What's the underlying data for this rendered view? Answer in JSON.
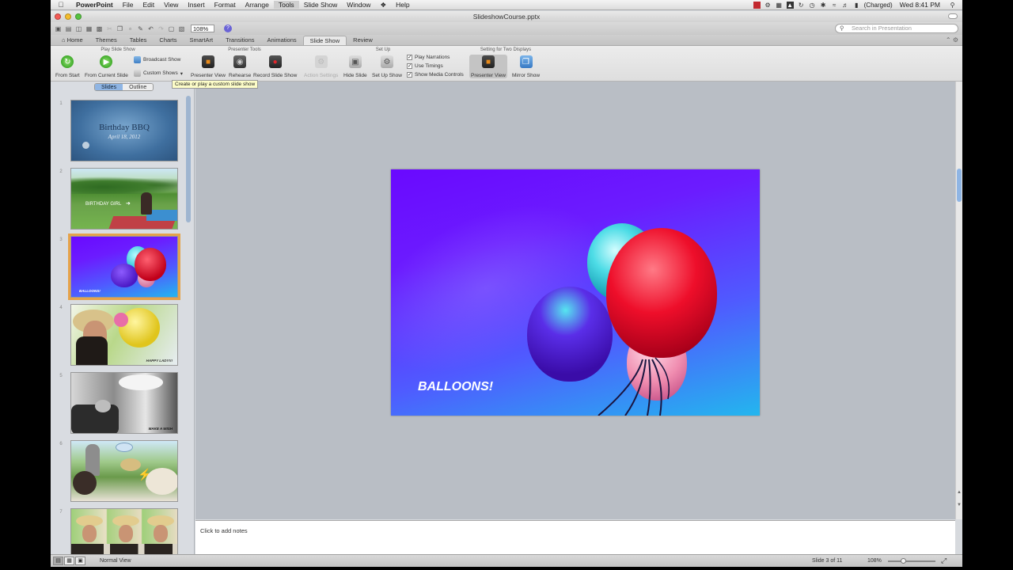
{
  "menubar": {
    "app_name": "PowerPoint",
    "items": [
      "File",
      "Edit",
      "View",
      "Insert",
      "Format",
      "Arrange",
      "Tools",
      "Slide Show",
      "Window",
      "Help"
    ],
    "battery": "(Charged)",
    "clock": "Wed 8:41 PM"
  },
  "window": {
    "title": "SlideshowCourse.pptx"
  },
  "toolbar": {
    "zoom": "108%",
    "search_placeholder": "Search in Presentation"
  },
  "ribbon": {
    "tabs": [
      "Home",
      "Themes",
      "Tables",
      "Charts",
      "SmartArt",
      "Transitions",
      "Animations",
      "Slide Show",
      "Review"
    ],
    "active_tab": "Slide Show",
    "groups": {
      "play": "Play Slide Show",
      "presenter": "Presenter Tools",
      "setup": "Set Up",
      "two_displays": "Setting for Two Displays"
    },
    "buttons": {
      "from_start": "From Start",
      "from_current": "From Current Slide",
      "broadcast": "Broadcast Show",
      "custom": "Custom Shows",
      "presenter_view": "Presenter View",
      "rehearse": "Rehearse",
      "record": "Record Slide Show",
      "action_settings": "Action Settings",
      "hide_slide": "Hide Slide",
      "set_up_show": "Set Up Show",
      "presenter_view_2": "Presenter View",
      "mirror_show": "Mirror Show"
    },
    "checkboxes": {
      "play_narrations": "Play Narrations",
      "use_timings": "Use Timings",
      "show_media_controls": "Show Media Controls"
    }
  },
  "tooltip": "Create or play a custom slide show",
  "slides_pane": {
    "tabs": [
      "Slides",
      "Outline"
    ],
    "thumbnails": [
      {
        "num": "1",
        "title": "Birthday BBQ",
        "subtitle": "April 18, 2012"
      },
      {
        "num": "2",
        "caption": "BIRTHDAY GIRL"
      },
      {
        "num": "3",
        "caption": "BALLOONS!"
      },
      {
        "num": "4",
        "caption": "HAPPY LADY!!!"
      },
      {
        "num": "5",
        "caption": "MAKE A WISH"
      },
      {
        "num": "6",
        "caption": ""
      },
      {
        "num": "7",
        "caption": ""
      }
    ]
  },
  "main_slide": {
    "caption": "BALLOONS!"
  },
  "notes": {
    "placeholder": "Click to add notes"
  },
  "status": {
    "view": "Normal View",
    "slide_count": "Slide 3 of 11",
    "zoom": "108%"
  }
}
